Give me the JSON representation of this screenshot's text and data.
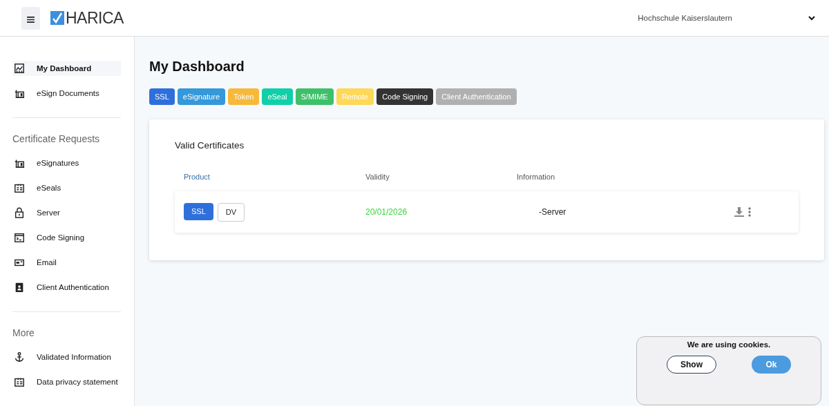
{
  "header": {
    "logo": "HARICA",
    "organization": "Hochschule Kaiserslautern"
  },
  "sidebar": {
    "sections": [
      {
        "items": [
          {
            "label": "My Dashboard",
            "selected": true
          },
          {
            "label": "eSign Documents",
            "selected": false
          }
        ]
      },
      {
        "title": "Certificate Requests",
        "items": [
          {
            "label": "eSignatures",
            "selected": false
          },
          {
            "label": "eSeals",
            "selected": false
          },
          {
            "label": "Server",
            "selected": false
          },
          {
            "label": "Code Signing",
            "selected": false
          },
          {
            "label": "Email",
            "selected": false
          },
          {
            "label": "Client Authentication",
            "selected": false
          }
        ]
      },
      {
        "title": "More",
        "items": [
          {
            "label": "Validated Information",
            "selected": false
          },
          {
            "label": "Data privacy statement",
            "selected": false
          }
        ]
      }
    ]
  },
  "page_title": "My Dashboard",
  "filters": [
    {
      "label": "SSL",
      "color": "#2f6fdc"
    },
    {
      "label": "eSignature",
      "color": "#3498db"
    },
    {
      "label": "Token",
      "color": "#f6b93b"
    },
    {
      "label": "eSeal",
      "color": "#11cfa8"
    },
    {
      "label": "S/MIME",
      "color": "#3ec06a"
    },
    {
      "label": "Remote",
      "color": "#fed858"
    },
    {
      "label": "Code Signing",
      "color": "#333333"
    },
    {
      "label": "Client Authentication",
      "color": "#b0b0b0"
    }
  ],
  "certificates": {
    "title": "Valid Certificates",
    "columns": [
      "Product",
      "Validity",
      "Information"
    ],
    "rows": [
      {
        "product": "SSL",
        "validation": "DV",
        "validity": "20/01/2026",
        "information": "-Server"
      }
    ]
  },
  "cookie_banner": {
    "message": "We are using cookies.",
    "buttons": [
      "Show",
      "Ok"
    ]
  }
}
